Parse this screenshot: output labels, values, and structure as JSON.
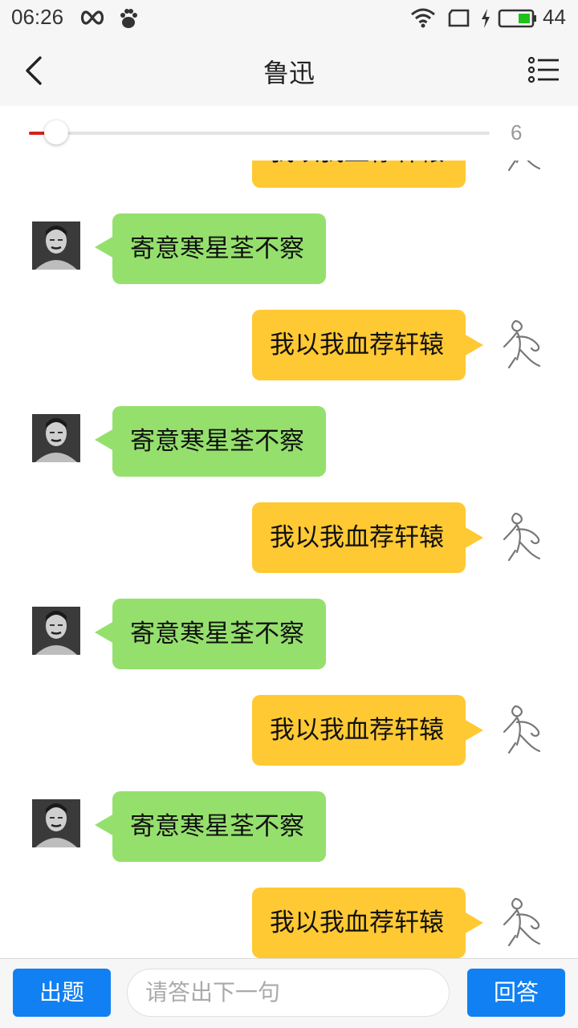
{
  "status": {
    "time": "06:26",
    "battery": "44"
  },
  "header": {
    "title": "鲁迅"
  },
  "slider": {
    "count": "6",
    "progress": 0.06
  },
  "messages": {
    "left": "寄意寒星荃不察",
    "right": "我以我血荐轩辕"
  },
  "bottom": {
    "ask_label": "出题",
    "answer_label": "回答",
    "input_placeholder": "请答出下一句"
  }
}
